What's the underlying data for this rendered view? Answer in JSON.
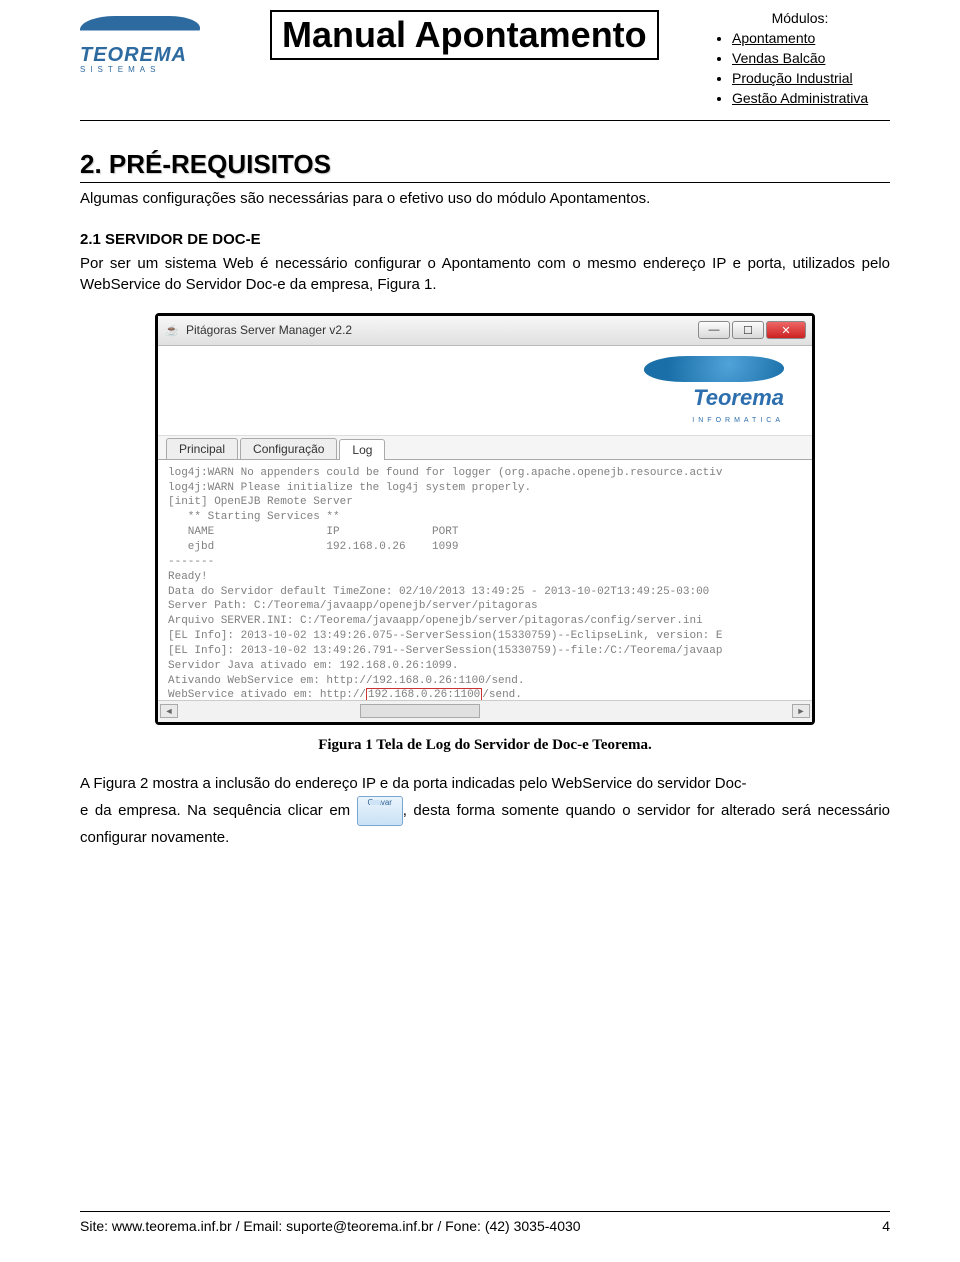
{
  "header": {
    "title": "Manual Apontamento",
    "logo_main": "TEOREMA",
    "logo_sub": "SISTEMAS",
    "modules_label": "Módulos:",
    "modules": [
      "Apontamento",
      "Vendas Balcão",
      "Produção Industrial",
      "Gestão Administrativa"
    ]
  },
  "section": {
    "number_title": "2.   PRÉ-REQUISITOS",
    "intro": "Algumas configurações são necessárias para o efetivo uso do módulo Apontamentos.",
    "sub_title": "2.1 SERVIDOR DE DOC-E",
    "sub_body": "Por ser um sistema Web é necessário configurar o Apontamento com o mesmo endereço IP e porta, utilizados pelo WebService do Servidor Doc-e da empresa, Figura 1."
  },
  "window": {
    "title": "Pitágoras Server Manager v2.2",
    "tabs": [
      "Principal",
      "Configuração",
      "Log"
    ],
    "log_lines": [
      "log4j:WARN No appenders could be found for logger (org.apache.openejb.resource.activ",
      "log4j:WARN Please initialize the log4j system properly.",
      "[init] OpenEJB Remote Server",
      "   ** Starting Services **",
      "   NAME                 IP              PORT",
      "   ejbd                 192.168.0.26    1099",
      "-------",
      "Ready!",
      "Data do Servidor default TimeZone: 02/10/2013 13:49:25 - 2013-10-02T13:49:25-03:00",
      "Server Path: C:/Teorema/javaapp/openejb/server/pitagoras",
      "Arquivo SERVER.INI: C:/Teorema/javaapp/openejb/server/pitagoras/config/server.ini",
      "[EL Info]: 2013-10-02 13:49:26.075--ServerSession(15330759)--EclipseLink, version: E",
      "[EL Info]: 2013-10-02 13:49:26.791--ServerSession(15330759)--file:/C:/Teorema/javaap",
      "Servidor Java ativado em: 192.168.0.26:1099.",
      "Ativando WebService em: http://192.168.0.26:1100/send.",
      "WebService ativado em: http://"
    ],
    "log_highlight": "192.168.0.26:1100",
    "log_trail": "/send.",
    "logo_text": "Teorema",
    "logo_sub": "INFORMATICA"
  },
  "caption": "Figura 1 Tela de Log do Servidor de Doc-e Teorema.",
  "after": {
    "p1a": "A Figura 2 mostra a inclusão do endereço IP e da porta indicadas pelo WebService do servidor Doc-",
    "p1b_start": "e da empresa. Na sequência clicar em ",
    "gravar_label": "Gravar",
    "p1b_end": ", desta forma somente quando o servidor for alterado será necessário configurar novamente."
  },
  "footer": {
    "left": "Site: www.teorema.inf.br / Email: suporte@teorema.inf.br / Fone: (42) 3035-4030",
    "right": "4"
  }
}
